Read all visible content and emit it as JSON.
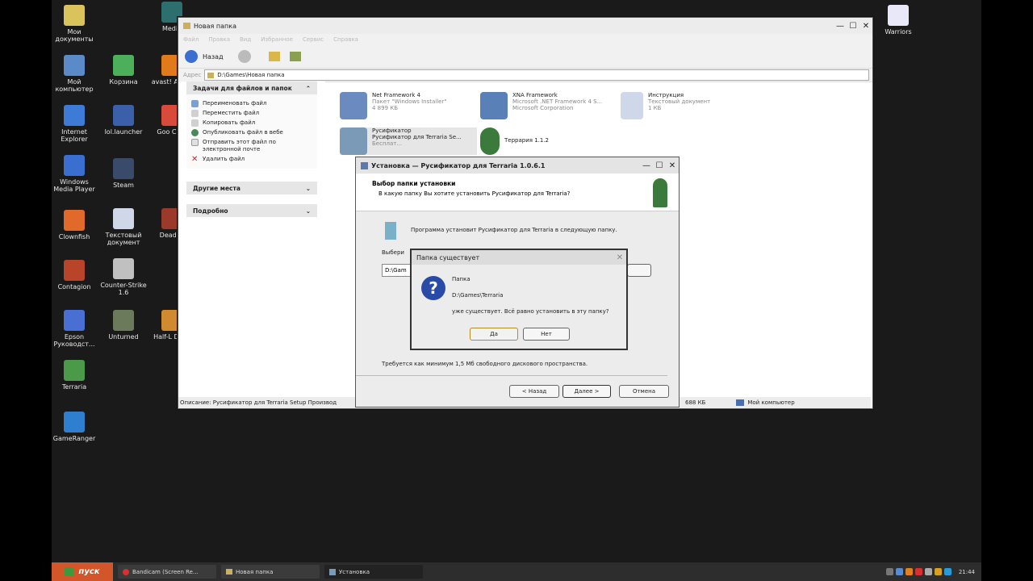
{
  "desktop_icons": [
    {
      "label": "Мои документы",
      "color": "#d9c35a"
    },
    {
      "label": "Мой компьютер",
      "color": "#5b8ac9"
    },
    {
      "label": "Internet Explorer",
      "color": "#3d7bd6"
    },
    {
      "label": "Windows Media Player",
      "color": "#3a6fd0"
    },
    {
      "label": "Clownfish",
      "color": "#e16a2b"
    },
    {
      "label": "Contagion",
      "color": "#b8452a"
    },
    {
      "label": "Epson Руководст...",
      "color": "#4a6fd3"
    },
    {
      "label": "Terraria",
      "color": "#4a9a4a"
    },
    {
      "label": "GameRanger",
      "color": "#2f7fd0"
    },
    {
      "label": "Корзина",
      "color": "#4cb05a"
    },
    {
      "label": "lol.launcher",
      "color": "#3b5fa9"
    },
    {
      "label": "Steam",
      "color": "#3a4a6a"
    },
    {
      "label": "Текстовый документ",
      "color": "#cfd8e8"
    },
    {
      "label": "Counter-Strike 1.6",
      "color": "#c0c0c0"
    },
    {
      "label": "Unturned",
      "color": "#6a7a5a"
    },
    {
      "label": "Media",
      "color": "#2d6f6f"
    },
    {
      "label": "avast! Antivi",
      "color": "#e07a1a"
    },
    {
      "label": "Goo Chro",
      "color": "#d84a3a"
    },
    {
      "label": "DeadOr",
      "color": "#9a3a2a"
    },
    {
      "label": "Half-L Deco",
      "color": "#d08a30"
    },
    {
      "label": "Warriors",
      "color": "#e8e8f8"
    }
  ],
  "explorer": {
    "title": "Новая папка",
    "menu": [
      "Файл",
      "Правка",
      "Вид",
      "Избранное",
      "Сервис",
      "Справка"
    ],
    "back_label": "Назад",
    "address_label": "Адрес",
    "address_value": "D:\\Games\\Новая папка",
    "tasks_header": "Задачи для файлов и папок",
    "tasks": [
      "Переименовать файл",
      "Переместить файл",
      "Копировать файл",
      "Опубликовать файл в вебе",
      "Отправить этот файл по электронной почте",
      "Удалить файл"
    ],
    "other_places": "Другие места",
    "details": "Подробно",
    "files": [
      {
        "name": "Net Framework 4",
        "sub1": "Пакет \"Windows Installer\"",
        "sub2": "4 899 КБ"
      },
      {
        "name": "XNA Framework",
        "sub1": "Microsoft .NET Framework 4 S...",
        "sub2": "Microsoft Corporation"
      },
      {
        "name": "Инструкция",
        "sub1": "Текстовый документ",
        "sub2": "1 КБ"
      },
      {
        "name": "Русификатор",
        "sub1": "Русификатор для Terraria Se...",
        "sub2": "Бесплат..."
      },
      {
        "name": "Террария 1.1.2",
        "sub1": "",
        "sub2": ""
      }
    ],
    "status_left": "Описание: Русификатор для Terraria Setup Производ",
    "status_size": "688 КБ",
    "status_computer": "Мой компьютер"
  },
  "installer": {
    "title": "Установка — Русификатор для Terraria 1.0.6.1",
    "heading": "Выбор папки установки",
    "subheading": "В какую папку Вы хотите установить Русификатор для Terraria?",
    "info": "Программа установит Русификатор для Terraria в следующую папку.",
    "select_label": "Выбери",
    "path_value": "D:\\Gam",
    "space_note": "Требуется как минимум 1,5 Мб свободного дискового пространства.",
    "back": "< Назад",
    "next": "Далее >",
    "cancel": "Отмена"
  },
  "messagebox": {
    "title": "Папка существует",
    "line1": "Папка",
    "line2": "D:\\Games\\Terraria",
    "line3": "уже существует. Всё равно установить в эту папку?",
    "yes": "Да",
    "no": "Нет"
  },
  "taskbar": {
    "start": "пуск",
    "items": [
      "Bandicam (Screen Re...",
      "Новая папка",
      "Установка"
    ],
    "clock": "21:44"
  }
}
